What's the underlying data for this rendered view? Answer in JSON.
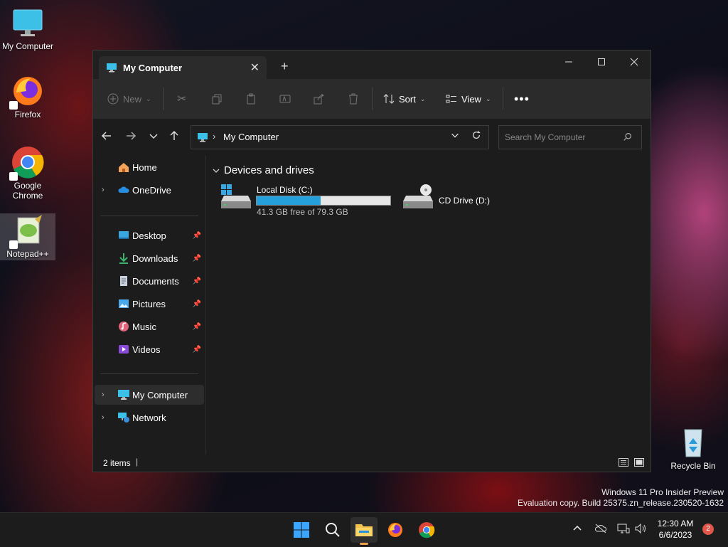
{
  "desktop": {
    "icons": [
      {
        "label": "My Computer"
      },
      {
        "label": "Firefox"
      },
      {
        "label": "Google Chrome"
      },
      {
        "label": "Notepad++"
      },
      {
        "label": "Recycle Bin"
      }
    ],
    "watermark": {
      "line1": "Windows 11 Pro Insider Preview",
      "line2": "Evaluation copy. Build 25375.zn_release.230520-1632"
    }
  },
  "window": {
    "tab_title": "My Computer",
    "toolbar": {
      "new_label": "New",
      "sort_label": "Sort",
      "view_label": "View"
    },
    "address": {
      "path": "My Computer"
    },
    "search": {
      "placeholder": "Search My Computer"
    },
    "sidebar": {
      "items": [
        {
          "label": "Home"
        },
        {
          "label": "OneDrive"
        },
        {
          "label": "Desktop"
        },
        {
          "label": "Downloads"
        },
        {
          "label": "Documents"
        },
        {
          "label": "Pictures"
        },
        {
          "label": "Music"
        },
        {
          "label": "Videos"
        },
        {
          "label": "My Computer"
        },
        {
          "label": "Network"
        }
      ]
    },
    "content": {
      "group_header": "Devices and drives",
      "drives": [
        {
          "name": "Local Disk (C:)",
          "info": "41.3 GB free of 79.3 GB",
          "used_fraction": 0.48
        },
        {
          "name": "CD Drive (D:)"
        }
      ]
    },
    "status": {
      "items": "2 items"
    }
  },
  "taskbar": {
    "time": "12:30 AM",
    "date": "6/6/2023",
    "notification_count": "2"
  },
  "colors": {
    "accent": "#26a0da",
    "window_bg": "#1c1c1c",
    "toolbar_bg": "#2b2b2b"
  }
}
